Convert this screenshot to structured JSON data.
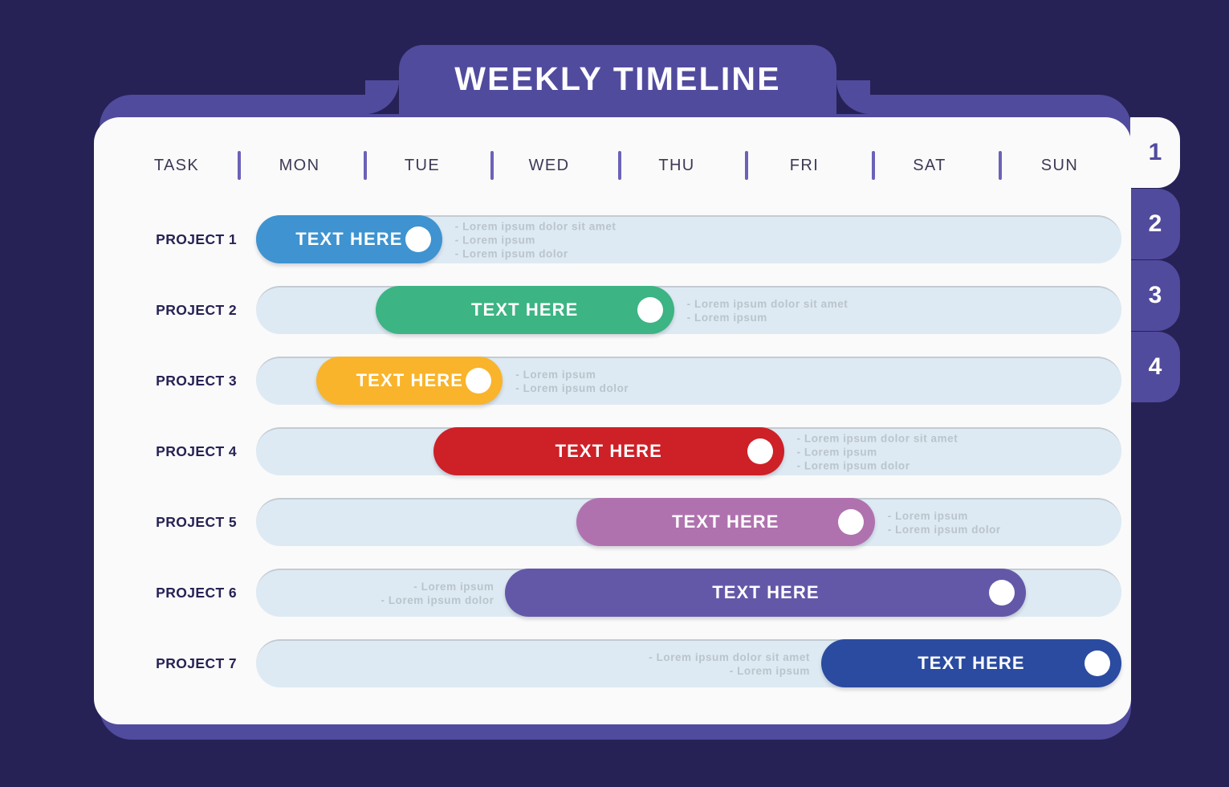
{
  "theme": {
    "background": "#262255",
    "plate": "#514B9E",
    "card": "#FAFAFA",
    "track": "#DEEAF3",
    "note_text": "#B9C4CC",
    "label_text": "#262255",
    "header_text": "#3C3A55",
    "separator": "#6B62B8"
  },
  "header": {
    "title": "WEEKLY TIMELINE"
  },
  "columns": [
    "TASK",
    "MON",
    "TUE",
    "WED",
    "THU",
    "FRI",
    "SAT",
    "SUN"
  ],
  "side_tabs": [
    {
      "label": "1",
      "active": true
    },
    {
      "label": "2",
      "active": false
    },
    {
      "label": "3",
      "active": false
    },
    {
      "label": "4",
      "active": false
    }
  ],
  "rows": [
    {
      "label": "PROJECT 1",
      "bar_label": "TEXT HERE",
      "color": "#3E93D0",
      "start_pct": 0,
      "width_pct": 21.5,
      "notes_side": "right",
      "notes": [
        "- Lorem ipsum dolor sit amet",
        "- Lorem ipsum",
        "- Lorem ipsum dolor"
      ]
    },
    {
      "label": "PROJECT 2",
      "bar_label": "TEXT HERE",
      "color": "#3CB483",
      "start_pct": 13.8,
      "width_pct": 34.5,
      "notes_side": "right",
      "notes": [
        "- Lorem ipsum dolor sit amet",
        "- Lorem ipsum"
      ]
    },
    {
      "label": "PROJECT 3",
      "bar_label": "TEXT HERE",
      "color": "#F9B42B",
      "start_pct": 7.0,
      "width_pct": 21.5,
      "notes_side": "right",
      "notes": [
        "- Lorem ipsum",
        "- Lorem ipsum dolor"
      ]
    },
    {
      "label": "PROJECT 4",
      "bar_label": "TEXT HERE",
      "color": "#CE2027",
      "start_pct": 20.5,
      "width_pct": 40.5,
      "notes_side": "right",
      "notes": [
        "- Lorem ipsum dolor sit amet",
        "- Lorem ipsum",
        "- Lorem ipsum dolor"
      ]
    },
    {
      "label": "PROJECT 5",
      "bar_label": "TEXT HERE",
      "color": "#B072AF",
      "start_pct": 37.0,
      "width_pct": 34.5,
      "notes_side": "right",
      "notes": [
        "- Lorem ipsum",
        "- Lorem ipsum dolor"
      ]
    },
    {
      "label": "PROJECT 6",
      "bar_label": "TEXT HERE",
      "color": "#6358A8",
      "start_pct": 28.8,
      "width_pct": 60.2,
      "notes_side": "left",
      "notes": [
        "- Lorem ipsum",
        "- Lorem ipsum dolor"
      ]
    },
    {
      "label": "PROJECT 7",
      "bar_label": "TEXT HERE",
      "color": "#2B4BA0",
      "start_pct": 65.3,
      "width_pct": 34.7,
      "notes_side": "left",
      "notes": [
        "- Lorem ipsum dolor sit amet",
        "- Lorem ipsum"
      ]
    }
  ]
}
